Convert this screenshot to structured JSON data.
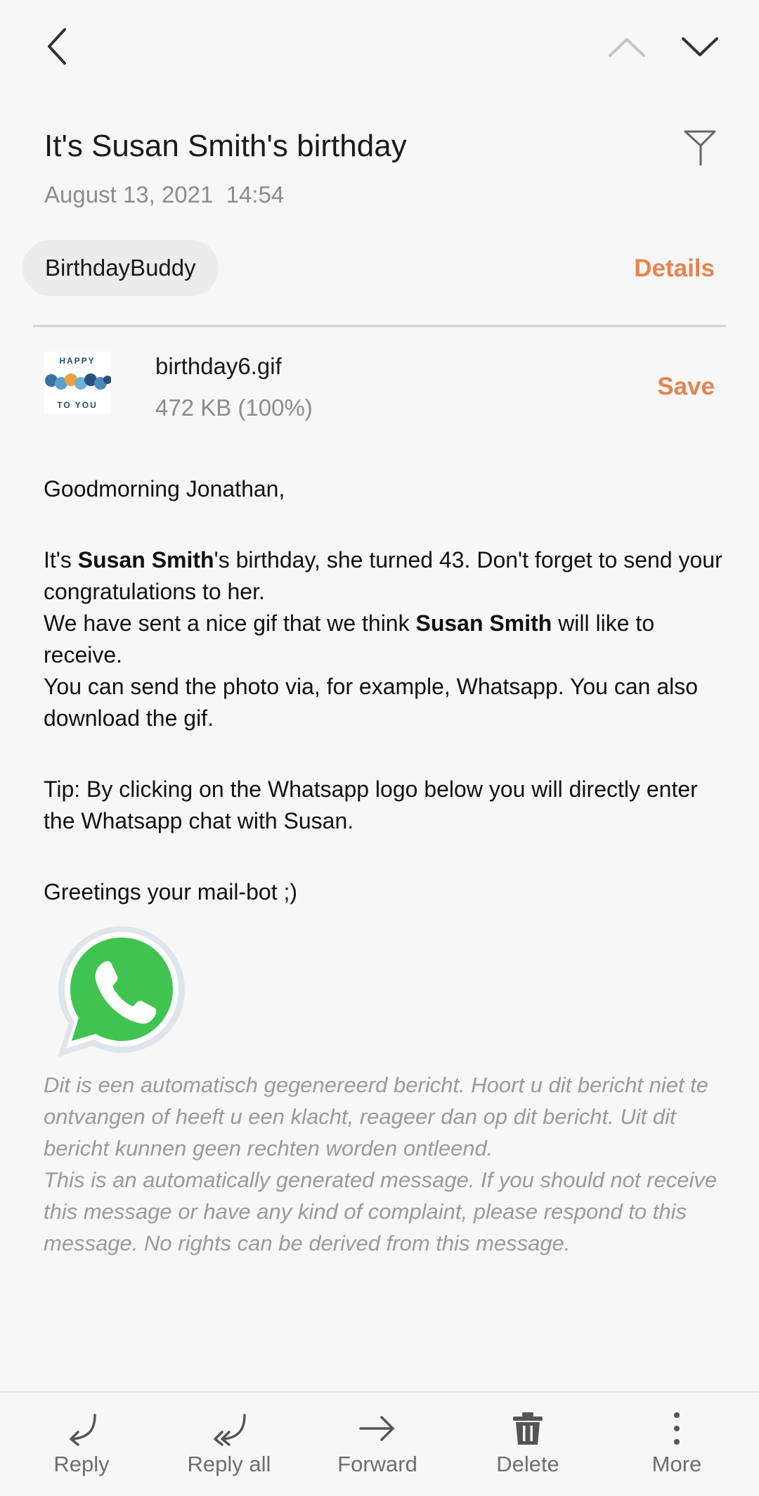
{
  "header": {
    "subject": "It's Susan Smith's birthday",
    "date": "August 13, 2021  14:54"
  },
  "sender": {
    "name": "BirthdayBuddy",
    "details_label": "Details"
  },
  "attachment": {
    "filename": "birthday6.gif",
    "size": "472 KB (100%)",
    "save_label": "Save",
    "thumb_text_top": "HAPPY",
    "thumb_text_bottom": "TO YOU"
  },
  "body": {
    "greeting": "Goodmorning Jonathan,",
    "p1_a": "It's ",
    "p1_name": "Susan Smith",
    "p1_b": "'s birthday, she turned 43. Don't forget to send your congratulations to her.",
    "p2_a": "We have sent a nice gif that we think ",
    "p2_name": "Susan Smith",
    "p2_b": " will like to receive.",
    "p3": "You can send the photo via, for example, Whatsapp. You can also download the gif.",
    "tip": "Tip: By clicking on the Whatsapp logo below you will directly enter the Whatsapp chat with Susan.",
    "signoff": "Greetings your mail-bot ;)"
  },
  "disclaimer": {
    "dutch": "Dit is een automatisch gegenereerd bericht. Hoort u dit bericht niet te ontvangen of heeft u een klacht, reageer dan op dit bericht. Uit dit bericht kunnen geen rechten worden ontleend.",
    "english": "This is an automatically generated message. If you should not receive this message or have any kind of complaint, please respond to this message. No rights can be derived from this message."
  },
  "actions": {
    "reply": "Reply",
    "reply_all": "Reply all",
    "forward": "Forward",
    "delete": "Delete",
    "more": "More"
  },
  "colors": {
    "accent": "#e5844f",
    "whatsapp_green": "#40c351"
  }
}
